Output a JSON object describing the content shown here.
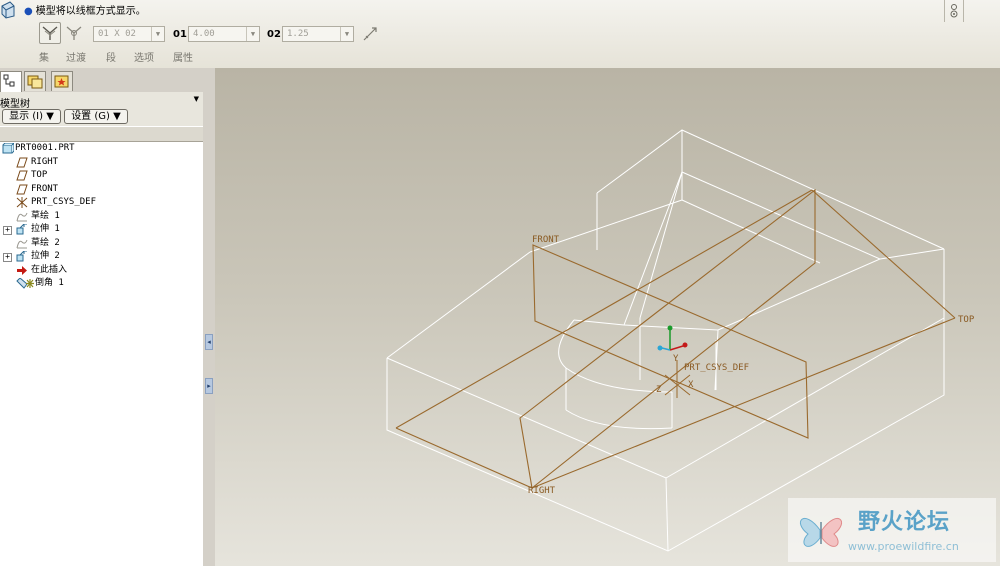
{
  "dashboard": {
    "message": "模型将以线框方式显示。",
    "set_label": "集",
    "transition_label": "过渡",
    "segment_label": "段",
    "options_label": "选项",
    "properties_label": "属性",
    "ref_combo": "01 X 02",
    "d1_label": "01",
    "d1_value": "4.00",
    "d2_label": "02",
    "d2_value": "1.25"
  },
  "navigator": {
    "tree_title": "模型树",
    "show_button": "显示 (I) ▼",
    "settings_button": "设置 (G) ▼",
    "items": [
      {
        "label": "PRT0001.PRT",
        "icon": "part-icon"
      },
      {
        "label": "RIGHT",
        "icon": "datum-plane-icon"
      },
      {
        "label": "TOP",
        "icon": "datum-plane-icon"
      },
      {
        "label": "FRONT",
        "icon": "datum-plane-icon"
      },
      {
        "label": "PRT_CSYS_DEF",
        "icon": "csys-icon"
      },
      {
        "label": "草绘 1",
        "icon": "sketch-icon"
      },
      {
        "label": "拉伸 1",
        "icon": "extrude-icon"
      },
      {
        "label": "草绘 2",
        "icon": "sketch-icon"
      },
      {
        "label": "拉伸 2",
        "icon": "extrude-icon"
      },
      {
        "label": "在此插入",
        "icon": "insert-arrow-icon"
      },
      {
        "label": "倒角 1",
        "icon": "chamfer-icon"
      }
    ]
  },
  "graphics": {
    "plane_front": "FRONT",
    "plane_top": "TOP",
    "plane_right": "RIGHT",
    "csys_label": "PRT_CSYS_DEF",
    "axis_x": "X",
    "axis_y": "Y",
    "axis_z": "Z"
  },
  "watermark": {
    "title": "野火论坛",
    "url": "www.proewildfire.cn"
  }
}
